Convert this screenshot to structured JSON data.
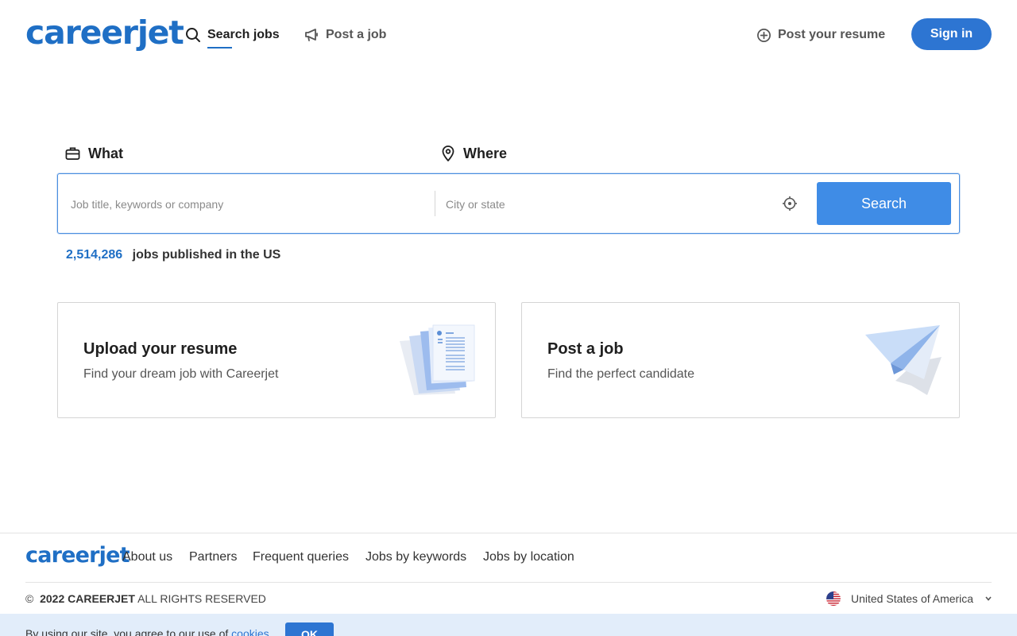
{
  "header": {
    "logo": "careerjet",
    "nav": {
      "search_jobs": "Search jobs",
      "post_job": "Post a job",
      "post_resume": "Post your resume"
    },
    "sign_in": "Sign in"
  },
  "search": {
    "what_label": "What",
    "where_label": "Where",
    "what_placeholder": "Job title, keywords or company",
    "where_placeholder": "City or state",
    "button": "Search",
    "count": "2,514,286",
    "count_suffix": "jobs published in the US"
  },
  "cards": [
    {
      "title": "Upload your resume",
      "subtitle": "Find your dream job with Careerjet",
      "icon": "resume-documents-illustration"
    },
    {
      "title": "Post a job",
      "subtitle": "Find the perfect candidate",
      "icon": "paper-plane-illustration"
    }
  ],
  "footer": {
    "logo": "careerjet",
    "links": [
      "About us",
      "Partners",
      "Frequent queries",
      "Jobs by keywords",
      "Jobs by location"
    ],
    "copyright_symbol": "©",
    "copyright_year_brand": "2022 CAREERJET",
    "copyright_rest": "ALL RIGHTS RESERVED",
    "country": "United States of America"
  },
  "cookie": {
    "text": "By using our site, you agree to our use of",
    "link": "cookies",
    "ok": "OK"
  },
  "colors": {
    "brand": "#1f6fc5",
    "button": "#2d75d2",
    "search_button": "#3f8ce6",
    "cookie_bg": "#e2edfa"
  }
}
